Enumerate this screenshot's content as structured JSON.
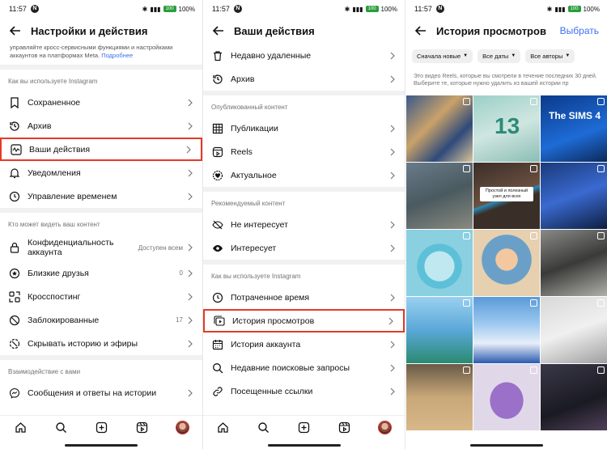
{
  "status": {
    "time": "11:57",
    "battery": "100%",
    "battery_level": "100"
  },
  "panel1": {
    "title": "Настройки и действия",
    "description": "управляйте кросс-сервисными функциями и настройками аккаунтов на платформах Meta.",
    "description_link": "Подробнее",
    "section1": "Как вы используете Instagram",
    "items1": [
      {
        "label": "Сохраненное",
        "icon": "bookmark-icon"
      },
      {
        "label": "Архив",
        "icon": "archive-icon"
      },
      {
        "label": "Ваши действия",
        "icon": "activity-icon"
      },
      {
        "label": "Уведомления",
        "icon": "bell-icon"
      },
      {
        "label": "Управление временем",
        "icon": "clock-icon"
      }
    ],
    "section2": "Кто может видеть ваш контент",
    "items2": [
      {
        "label": "Конфиденциальность аккаунта",
        "value": "Доступен всем",
        "icon": "lock-icon"
      },
      {
        "label": "Близкие друзья",
        "value": "0",
        "icon": "star-icon"
      },
      {
        "label": "Кросспостинг",
        "value": "",
        "icon": "crosspost-icon"
      },
      {
        "label": "Заблокированные",
        "value": "17",
        "icon": "block-icon"
      },
      {
        "label": "Скрывать историю и эфиры",
        "value": "",
        "icon": "hide-story-icon"
      }
    ],
    "section3": "Взаимодействие с вами",
    "items3": [
      {
        "label": "Сообщения и ответы на истории",
        "icon": "messenger-icon"
      }
    ]
  },
  "panel2": {
    "title": "Ваши действия",
    "items0": [
      {
        "label": "Недавно удаленные",
        "icon": "trash-icon"
      },
      {
        "label": "Архив",
        "icon": "archive-icon"
      }
    ],
    "section1": "Опубликованный контент",
    "items1": [
      {
        "label": "Публикации",
        "icon": "grid-icon"
      },
      {
        "label": "Reels",
        "icon": "reels-icon"
      },
      {
        "label": "Актуальное",
        "icon": "highlights-icon"
      }
    ],
    "section2": "Рекомендуемый контент",
    "items2": [
      {
        "label": "Не интересует",
        "icon": "eye-off-icon"
      },
      {
        "label": "Интересует",
        "icon": "eye-icon"
      }
    ],
    "section3": "Как вы используете Instagram",
    "items3": [
      {
        "label": "Потраченное время",
        "icon": "clock-icon"
      },
      {
        "label": "История просмотров",
        "icon": "watch-history-icon"
      },
      {
        "label": "История аккаунта",
        "icon": "calendar-icon"
      },
      {
        "label": "Недавние поисковые запросы",
        "icon": "search-icon"
      },
      {
        "label": "Посещенные ссылки",
        "icon": "link-icon"
      }
    ]
  },
  "panel3": {
    "title": "История просмотров",
    "select_label": "Выбрать",
    "filters": [
      "Сначала новые",
      "Все даты",
      "Все авторы"
    ],
    "note": "Это видео Reels, которые вы смотрели в течение последних 30 дней. Выберите те, которые нужно удалить из вашей истории пр",
    "tile_caption": "Простой и полезный узел для всех",
    "tile_brand": "The SIMS 4",
    "tile_number": "13"
  },
  "colors": {
    "accent": "#3a6ff0",
    "highlight": "#e53a26"
  }
}
